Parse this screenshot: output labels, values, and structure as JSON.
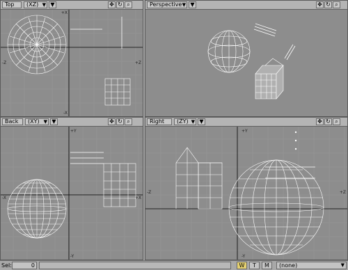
{
  "viewports": [
    {
      "id": "top",
      "view_label": "Top",
      "axis_label": "(XZ)"
    },
    {
      "id": "persp",
      "view_label": "Perspective",
      "axis_label": ""
    },
    {
      "id": "back",
      "view_label": "Back",
      "axis_label": "(XY)"
    },
    {
      "id": "right",
      "view_label": "Right",
      "axis_label": "(ZY)"
    }
  ],
  "axis_marks": {
    "top": {
      "plus_x": "+X",
      "minus_x": "-X",
      "minus_z": "-Z",
      "plus_z": "+Z"
    },
    "back": {
      "plus_y": "+Y",
      "minus_x": "-X",
      "plus_x": "+X",
      "minus_y": "-Y"
    },
    "right": {
      "plus_y": "+Y",
      "minus_z": "-Z",
      "plus_z": "+Z",
      "minus_y": "-Y"
    }
  },
  "icons": {
    "move": "move-arrows-icon",
    "rotate": "rotate-icon",
    "zoom": "magnifier-icon",
    "dropdown": "dropdown-arrow-icon"
  },
  "colors": {
    "viewport_bg": "#8d8d8d",
    "grid": "#969696",
    "axis": "#000000",
    "wire": "#ffffff",
    "mode_active": "#e4d070"
  },
  "status": {
    "sel_label": "Sel:",
    "sel_count": "0",
    "mode_w": "W",
    "mode_t": "T",
    "mode_m": "M",
    "layer_value": "(none)"
  }
}
